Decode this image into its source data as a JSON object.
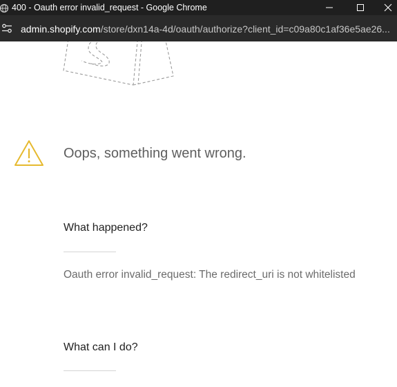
{
  "window": {
    "title": "400 - Oauth error invalid_request - Google Chrome"
  },
  "browser": {
    "url_host": "admin.shopify.com",
    "url_rest": "/store/dxn14a-4d/oauth/authorize?client_id=c09a80c1af36e5ae26..."
  },
  "error_page": {
    "heading": "Oops, something went wrong.",
    "sections": [
      {
        "title": "What happened?",
        "text": "Oauth error invalid_request: The redirect_uri is not whitelisted"
      },
      {
        "title": "What can I do?",
        "text": ""
      }
    ]
  },
  "icons": {
    "tab": "globe-icon",
    "site_info": "tune-icon",
    "logo": "shopify-bag-outline-icon",
    "alert": "warning-triangle-icon"
  },
  "colors": {
    "titlebar_bg": "#1f1f1f",
    "addressbar_bg": "#2a2a2a",
    "warning": "#e6b92e",
    "heading": "#5e5e5e",
    "section_title": "#212121",
    "body_text": "#6b6b6b"
  }
}
